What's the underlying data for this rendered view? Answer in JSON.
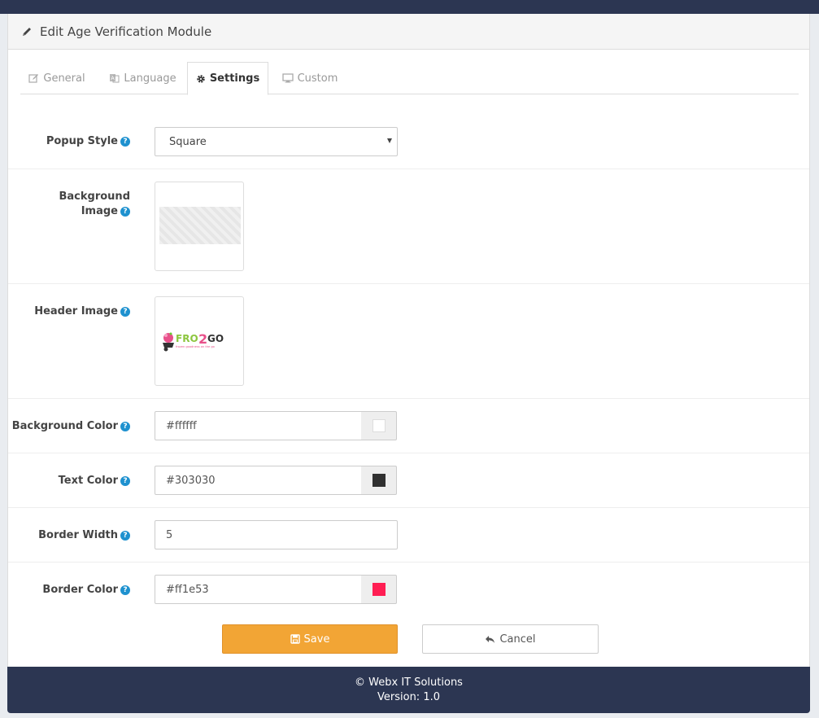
{
  "page": {
    "title": "Edit Age Verification Module"
  },
  "tabs": [
    {
      "label": "General",
      "icon": "edit-icon",
      "active": false
    },
    {
      "label": "Language",
      "icon": "language-icon",
      "active": false
    },
    {
      "label": "Settings",
      "icon": "gear-icon",
      "active": true
    },
    {
      "label": "Custom",
      "icon": "monitor-icon",
      "active": false
    }
  ],
  "form": {
    "popup_style": {
      "label": "Popup Style",
      "value": "Square"
    },
    "background_image": {
      "label_line1": "Background",
      "label_line2": "Image"
    },
    "header_image": {
      "label": "Header Image",
      "logo_text": "FRO2GO",
      "logo_tagline": "frozen goodness on the go"
    },
    "background_color": {
      "label": "Background Color",
      "value": "#ffffff"
    },
    "text_color": {
      "label": "Text Color",
      "value": "#303030"
    },
    "border_width": {
      "label": "Border Width",
      "value": "5"
    },
    "border_color": {
      "label": "Border Color",
      "value": "#ff1e53"
    }
  },
  "buttons": {
    "save": "Save",
    "cancel": "Cancel"
  },
  "footer": {
    "copyright": "© Webx IT Solutions",
    "version": "Version: 1.0"
  },
  "colors": {
    "header_bar": "#2c3652",
    "save_button": "#f2a535",
    "help_icon": "#1e91cf"
  }
}
